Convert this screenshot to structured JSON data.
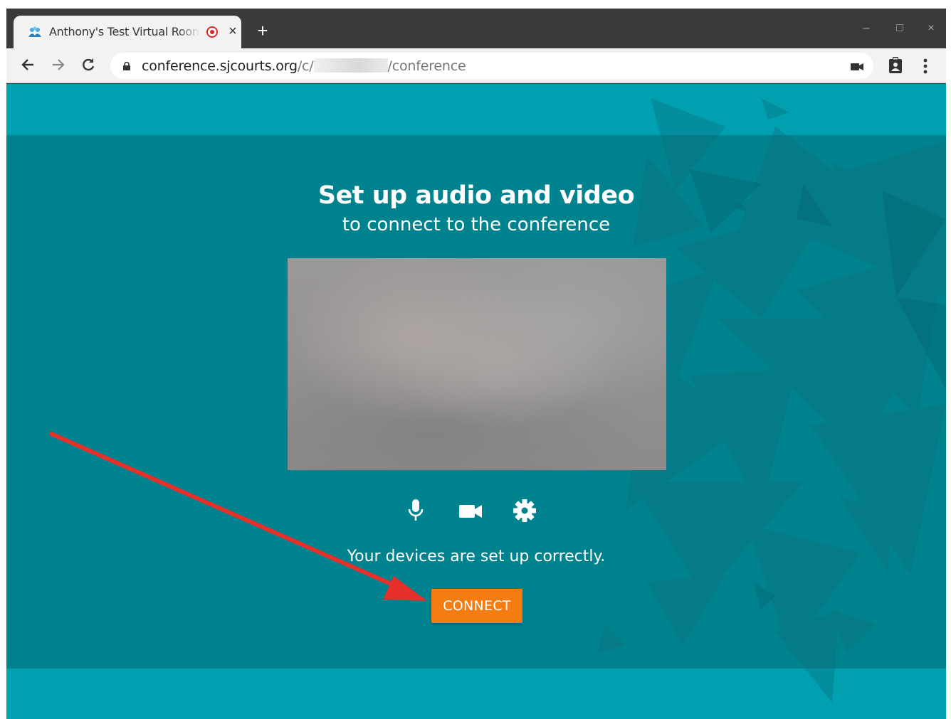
{
  "browser": {
    "tab_title": "Anthony's Test Virtual Room",
    "new_tab": "+",
    "tab_close": "×",
    "url_host": "conference.sjcourts.org",
    "url_prefix": "/c/",
    "url_suffix": "/conference",
    "minimize": "–",
    "maximize": "□",
    "close": "×"
  },
  "page": {
    "title": "Set up audio and video",
    "subtitle": "to connect to the conference",
    "status": "Your devices are set up correctly.",
    "connect_label": "CONNECT"
  },
  "colors": {
    "accent": "#f57c12",
    "teal_light": "#00a0b0",
    "teal_dark": "#00828f",
    "annotation_arrow": "#e8302a"
  }
}
